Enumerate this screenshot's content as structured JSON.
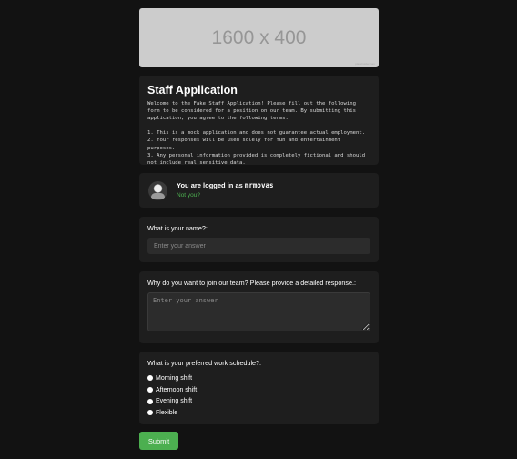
{
  "banner": {
    "text": "1600 x 400",
    "credit": "placeholder.com"
  },
  "intro": {
    "title": "Staff Application",
    "body": "Welcome to the Fake Staff Application! Please fill out the following form to be considered for a position on our team. By submitting this application, you agree to the following terms:\n\n1. This is a mock application and does not guarantee actual employment.\n2. Your responses will be used solely for fun and entertainment purposes.\n3. Any personal information provided is completely fictional and should not include real sensitive data."
  },
  "login": {
    "prefix": "You are logged in as ",
    "username": "mrmovas",
    "not_you": "Not you?"
  },
  "questions": {
    "name": {
      "label": "What is your name?:",
      "placeholder": "Enter your answer",
      "value": ""
    },
    "why": {
      "label": "Why do you want to join our team? Please provide a detailed response.:",
      "placeholder": "Enter your answer",
      "value": ""
    },
    "schedule": {
      "label": "What is your preferred work schedule?:",
      "options": [
        "Morning shift",
        "Afternoon shift",
        "Evening shift",
        "Flexible"
      ],
      "selected": null
    }
  },
  "submit_label": "Submit",
  "colors": {
    "background": "#121212",
    "card": "#1e1e1e",
    "input": "#2c2c2c",
    "accent": "#4caf50",
    "banner": "#cccccc"
  }
}
